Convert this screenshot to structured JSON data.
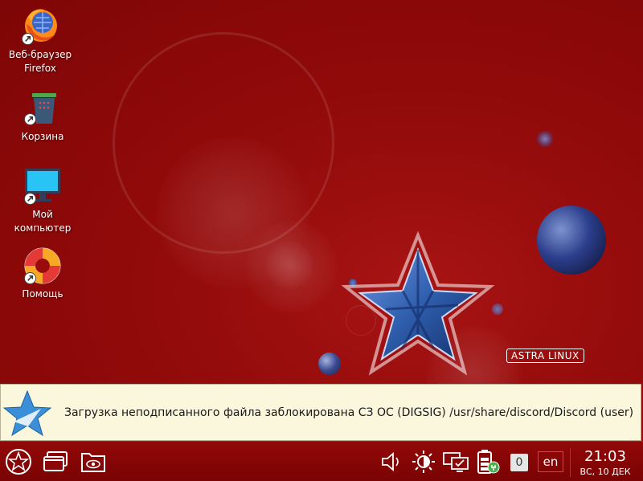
{
  "desktop": {
    "icons": [
      {
        "label_line1": "Веб-браузер",
        "label_line2": "Firefox",
        "icon": "firefox-icon"
      },
      {
        "label_line1": "Корзина",
        "icon": "trash-icon"
      },
      {
        "label_line1": "Мой",
        "label_line2": "компьютер",
        "icon": "computer-icon"
      },
      {
        "label_line1": "Помощь",
        "icon": "lifebuoy-icon"
      }
    ],
    "brand": "ASTRA LINUX"
  },
  "notification": {
    "icon": "astra-star-icon",
    "text": "Загрузка неподписанного файла заблокирована СЗ ОС (DIGSIG) /usr/share/discord/Discord (user)"
  },
  "taskbar": {
    "start_icon": "astra-start-icon",
    "windows_icon": "window-switcher-icon",
    "files_icon": "file-manager-icon",
    "tray": {
      "volume_icon": "speaker-icon",
      "brightness_icon": "brightness-icon",
      "network_icon": "network-display-icon",
      "battery_icon": "battery-charging-icon",
      "notifications_count": "0",
      "keyboard_layout": "en"
    },
    "clock": {
      "time": "21:03",
      "date": "ВС, 10 ДЕК"
    }
  },
  "colors": {
    "desktop_red": "#8a0808",
    "notification_bg": "#fbf7dc",
    "star_blue": "#2f5fae"
  }
}
